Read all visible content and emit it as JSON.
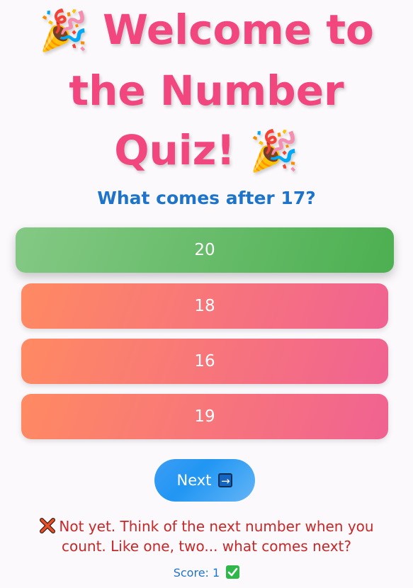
{
  "header": {
    "line1": "Welcome to",
    "line2": "the Number",
    "line3": "Quiz!",
    "emoji": "🎉",
    "emoji_name": "party-popper-icon"
  },
  "question": {
    "text": "What comes after 17?"
  },
  "options": [
    {
      "label": "20",
      "state": "correct-highlight",
      "color": "#4caf50"
    },
    {
      "label": "18",
      "state": "default",
      "color": "#f06292"
    },
    {
      "label": "16",
      "state": "default",
      "color": "#f06292"
    },
    {
      "label": "19",
      "state": "default",
      "color": "#f06292"
    }
  ],
  "next_button": {
    "label": "Next",
    "icon": "right-arrow-icon"
  },
  "feedback": {
    "icon": "cross-mark-icon",
    "text": "Not yet. Think of the next number when you count. Like one, two... what comes next?",
    "color": "#c62828"
  },
  "score": {
    "label": "Score: 1",
    "icon": "check-mark-icon"
  },
  "colors": {
    "title": "#f2467e",
    "question": "#1e74c9",
    "background": "#fbf9fc"
  }
}
